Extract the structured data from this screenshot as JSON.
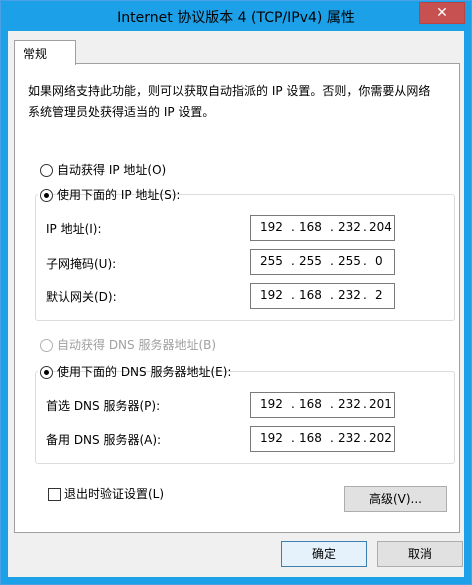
{
  "window": {
    "title": "Internet 协议版本 4 (TCP/IPv4) 属性",
    "close_symbol": "✕",
    "accent_color": "#1ca1e8"
  },
  "tabs": [
    {
      "label": "常规"
    }
  ],
  "description": "如果网络支持此功能，则可以获取自动指派的 IP 设置。否则，你需要从网络系统管理员处获得适当的 IP 设置。",
  "ip": {
    "auto_label": "自动获得 IP 地址(O)",
    "auto_selected": false,
    "manual_label": "使用下面的 IP 地址(S):",
    "manual_selected": true,
    "fields": [
      {
        "label": "IP 地址(I):",
        "octets": [
          "192",
          "168",
          "232",
          "204"
        ]
      },
      {
        "label": "子网掩码(U):",
        "octets": [
          "255",
          "255",
          "255",
          "0"
        ]
      },
      {
        "label": "默认网关(D):",
        "octets": [
          "192",
          "168",
          "232",
          "2"
        ]
      }
    ]
  },
  "dns": {
    "auto_label": "自动获得 DNS 服务器地址(B)",
    "auto_selected": false,
    "auto_disabled": true,
    "manual_label": "使用下面的 DNS 服务器地址(E):",
    "manual_selected": true,
    "fields": [
      {
        "label": "首选 DNS 服务器(P):",
        "octets": [
          "192",
          "168",
          "232",
          "201"
        ]
      },
      {
        "label": "备用 DNS 服务器(A):",
        "octets": [
          "192",
          "168",
          "232",
          "202"
        ]
      }
    ]
  },
  "validate": {
    "label": "退出时验证设置(L)",
    "checked": false
  },
  "buttons": {
    "advanced": "高级(V)...",
    "ok": "确定",
    "cancel": "取消"
  },
  "ip_separator": "."
}
